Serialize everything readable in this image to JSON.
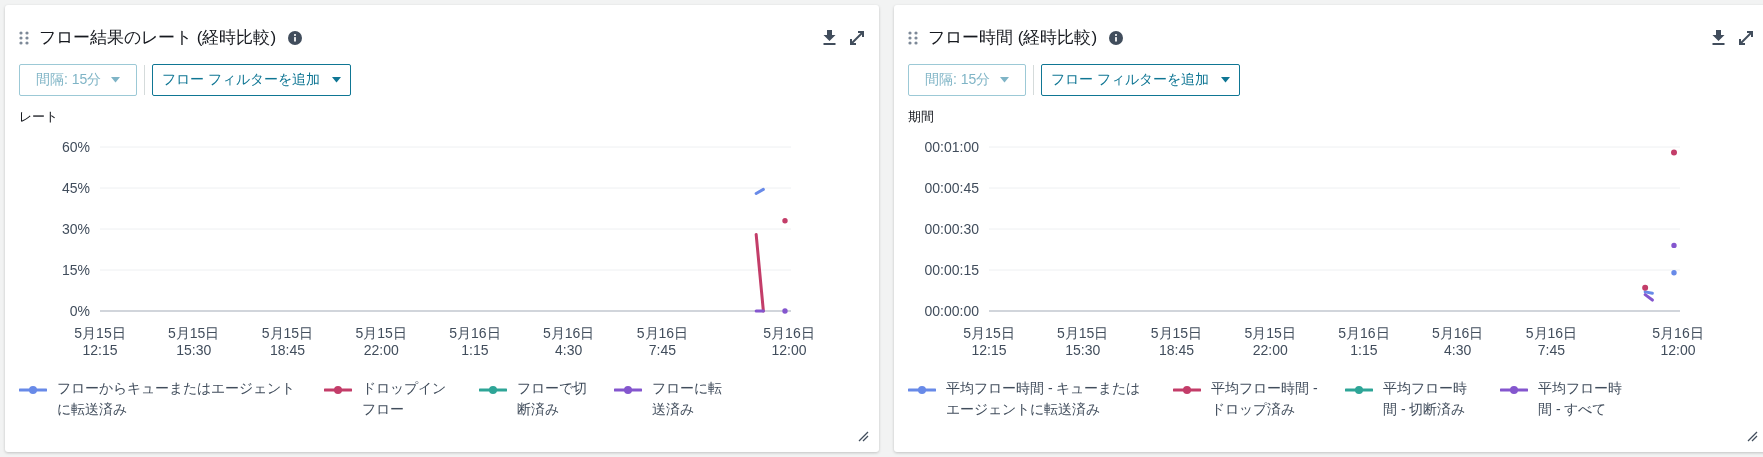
{
  "panels": [
    {
      "title": "フロー結果のレート (経時比較)",
      "interval": {
        "label": "間隔: 15分",
        "disabled": true
      },
      "filter": {
        "label": "フロー フィルターを追加"
      },
      "axis_label": "レート",
      "chart_data": {
        "type": "line",
        "grid": true,
        "legend": true,
        "categories": [
          "5月15日\n12:15",
          null,
          null,
          null,
          null,
          null,
          null,
          null,
          null,
          null,
          null,
          null,
          null,
          "5月15日\n15:30",
          null,
          null,
          null,
          null,
          null,
          null,
          null,
          null,
          null,
          null,
          null,
          null,
          "5月15日\n18:45",
          null,
          null,
          null,
          null,
          null,
          null,
          null,
          null,
          null,
          null,
          null,
          null,
          "5月15日\n22:00",
          null,
          null,
          null,
          null,
          null,
          null,
          null,
          null,
          null,
          null,
          null,
          null,
          "5月16日\n1:15",
          null,
          null,
          null,
          null,
          null,
          null,
          null,
          null,
          null,
          null,
          null,
          null,
          "5月16日\n4:30",
          null,
          null,
          null,
          null,
          null,
          null,
          null,
          null,
          null,
          null,
          null,
          null,
          "5月16日\n7:45",
          null,
          null,
          null,
          null,
          null,
          null,
          null,
          null,
          null,
          null,
          null,
          null,
          null,
          null,
          null,
          null,
          "5月16日\n12:00"
        ],
        "ylim": [
          0,
          60
        ],
        "yticks": [
          {
            "value": 0,
            "label": "0%"
          },
          {
            "value": 15,
            "label": "15%"
          },
          {
            "value": 30,
            "label": "30%"
          },
          {
            "value": 45,
            "label": "45%"
          },
          {
            "value": 60,
            "label": "60%"
          }
        ],
        "series": [
          {
            "name": "フローからキューまたはエージェントに転送済み",
            "color": "#688ae8",
            "values": [
              null,
              null,
              null,
              null,
              null,
              null,
              null,
              null,
              null,
              null,
              null,
              null,
              null,
              null,
              null,
              null,
              null,
              null,
              null,
              null,
              null,
              null,
              null,
              null,
              null,
              null,
              null,
              null,
              null,
              null,
              null,
              null,
              null,
              null,
              null,
              null,
              null,
              null,
              null,
              null,
              null,
              null,
              null,
              null,
              null,
              null,
              null,
              null,
              null,
              null,
              null,
              null,
              null,
              null,
              null,
              null,
              null,
              null,
              null,
              null,
              null,
              null,
              null,
              null,
              null,
              null,
              null,
              null,
              null,
              null,
              null,
              null,
              null,
              null,
              null,
              null,
              null,
              null,
              null,
              null,
              null,
              null,
              null,
              null,
              null,
              null,
              null,
              null,
              null,
              null,
              null,
              43,
              44.5,
              null,
              null,
              null
            ]
          },
          {
            "name": "ドロップインフロー",
            "color": "#c33d69",
            "values": [
              null,
              null,
              null,
              null,
              null,
              null,
              null,
              null,
              null,
              null,
              null,
              null,
              null,
              null,
              null,
              null,
              null,
              null,
              null,
              null,
              null,
              null,
              null,
              null,
              null,
              null,
              null,
              null,
              null,
              null,
              null,
              null,
              null,
              null,
              null,
              null,
              null,
              null,
              null,
              null,
              null,
              null,
              null,
              null,
              null,
              null,
              null,
              null,
              null,
              null,
              null,
              null,
              null,
              null,
              null,
              null,
              null,
              null,
              null,
              null,
              null,
              null,
              null,
              null,
              null,
              null,
              null,
              null,
              null,
              null,
              null,
              null,
              null,
              null,
              null,
              null,
              null,
              null,
              null,
              null,
              null,
              null,
              null,
              null,
              null,
              null,
              null,
              null,
              null,
              null,
              null,
              28,
              0,
              null,
              null,
              33
            ]
          },
          {
            "name": "フローで切断済み",
            "color": "#2ea597",
            "values": [
              null,
              null,
              null,
              null,
              null,
              null,
              null,
              null,
              null,
              null,
              null,
              null,
              null,
              null,
              null,
              null,
              null,
              null,
              null,
              null,
              null,
              null,
              null,
              null,
              null,
              null,
              null,
              null,
              null,
              null,
              null,
              null,
              null,
              null,
              null,
              null,
              null,
              null,
              null,
              null,
              null,
              null,
              null,
              null,
              null,
              null,
              null,
              null,
              null,
              null,
              null,
              null,
              null,
              null,
              null,
              null,
              null,
              null,
              null,
              null,
              null,
              null,
              null,
              null,
              null,
              null,
              null,
              null,
              null,
              null,
              null,
              null,
              null,
              null,
              null,
              null,
              null,
              null,
              null,
              null,
              null,
              null,
              null,
              null,
              null,
              null,
              null,
              null,
              null,
              null,
              null,
              null,
              null,
              null,
              null,
              null
            ]
          },
          {
            "name": "フローに転送済み",
            "color": "#8456ce",
            "values": [
              null,
              null,
              null,
              null,
              null,
              null,
              null,
              null,
              null,
              null,
              null,
              null,
              null,
              null,
              null,
              null,
              null,
              null,
              null,
              null,
              null,
              null,
              null,
              null,
              null,
              null,
              null,
              null,
              null,
              null,
              null,
              null,
              null,
              null,
              null,
              null,
              null,
              null,
              null,
              null,
              null,
              null,
              null,
              null,
              null,
              null,
              null,
              null,
              null,
              null,
              null,
              null,
              null,
              null,
              null,
              null,
              null,
              null,
              null,
              null,
              null,
              null,
              null,
              null,
              null,
              null,
              null,
              null,
              null,
              null,
              null,
              null,
              null,
              null,
              null,
              null,
              null,
              null,
              null,
              null,
              null,
              null,
              null,
              null,
              null,
              null,
              null,
              null,
              null,
              null,
              null,
              0,
              0,
              null,
              null,
              0
            ]
          }
        ]
      }
    },
    {
      "title": "フロー時間 (経時比較)",
      "interval": {
        "label": "間隔: 15分",
        "disabled": true
      },
      "filter": {
        "label": "フロー フィルターを追加"
      },
      "axis_label": "期間",
      "chart_data": {
        "type": "line",
        "grid": true,
        "legend": true,
        "categories": [
          "5月15日\n12:15",
          null,
          null,
          null,
          null,
          null,
          null,
          null,
          null,
          null,
          null,
          null,
          null,
          "5月15日\n15:30",
          null,
          null,
          null,
          null,
          null,
          null,
          null,
          null,
          null,
          null,
          null,
          null,
          "5月15日\n18:45",
          null,
          null,
          null,
          null,
          null,
          null,
          null,
          null,
          null,
          null,
          null,
          null,
          "5月15日\n22:00",
          null,
          null,
          null,
          null,
          null,
          null,
          null,
          null,
          null,
          null,
          null,
          null,
          "5月16日\n1:15",
          null,
          null,
          null,
          null,
          null,
          null,
          null,
          null,
          null,
          null,
          null,
          null,
          "5月16日\n4:30",
          null,
          null,
          null,
          null,
          null,
          null,
          null,
          null,
          null,
          null,
          null,
          null,
          "5月16日\n7:45",
          null,
          null,
          null,
          null,
          null,
          null,
          null,
          null,
          null,
          null,
          null,
          null,
          null,
          null,
          null,
          null,
          "5月16日\n12:00"
        ],
        "ylim": [
          0,
          60
        ],
        "yticks": [
          {
            "value": 0,
            "label": "00:00:00"
          },
          {
            "value": 15,
            "label": "00:00:15"
          },
          {
            "value": 30,
            "label": "00:00:30"
          },
          {
            "value": 45,
            "label": "00:00:45"
          },
          {
            "value": 60,
            "label": "00:01:00"
          }
        ],
        "series": [
          {
            "name": "平均フロー時間 - キューまたはエージェントに転送済み",
            "color": "#688ae8",
            "values": [
              null,
              null,
              null,
              null,
              null,
              null,
              null,
              null,
              null,
              null,
              null,
              null,
              null,
              null,
              null,
              null,
              null,
              null,
              null,
              null,
              null,
              null,
              null,
              null,
              null,
              null,
              null,
              null,
              null,
              null,
              null,
              null,
              null,
              null,
              null,
              null,
              null,
              null,
              null,
              null,
              null,
              null,
              null,
              null,
              null,
              null,
              null,
              null,
              null,
              null,
              null,
              null,
              null,
              null,
              null,
              null,
              null,
              null,
              null,
              null,
              null,
              null,
              null,
              null,
              null,
              null,
              null,
              null,
              null,
              null,
              null,
              null,
              null,
              null,
              null,
              null,
              null,
              null,
              null,
              null,
              null,
              null,
              null,
              null,
              null,
              null,
              null,
              null,
              null,
              null,
              null,
              7,
              6.5,
              null,
              null,
              14
            ]
          },
          {
            "name": "平均フロー時間 - ドロップ済み",
            "type": "scatter",
            "color": "#c33d69",
            "values": [
              null,
              null,
              null,
              null,
              null,
              null,
              null,
              null,
              null,
              null,
              null,
              null,
              null,
              null,
              null,
              null,
              null,
              null,
              null,
              null,
              null,
              null,
              null,
              null,
              null,
              null,
              null,
              null,
              null,
              null,
              null,
              null,
              null,
              null,
              null,
              null,
              null,
              null,
              null,
              null,
              null,
              null,
              null,
              null,
              null,
              null,
              null,
              null,
              null,
              null,
              null,
              null,
              null,
              null,
              null,
              null,
              null,
              null,
              null,
              null,
              null,
              null,
              null,
              null,
              null,
              null,
              null,
              null,
              null,
              null,
              null,
              null,
              null,
              null,
              null,
              null,
              null,
              null,
              null,
              null,
              null,
              null,
              null,
              null,
              null,
              null,
              null,
              null,
              null,
              null,
              null,
              8.5,
              null,
              null,
              null,
              58
            ]
          },
          {
            "name": "平均フロー時間 - 切断済み",
            "color": "#2ea597",
            "values": [
              null,
              null,
              null,
              null,
              null,
              null,
              null,
              null,
              null,
              null,
              null,
              null,
              null,
              null,
              null,
              null,
              null,
              null,
              null,
              null,
              null,
              null,
              null,
              null,
              null,
              null,
              null,
              null,
              null,
              null,
              null,
              null,
              null,
              null,
              null,
              null,
              null,
              null,
              null,
              null,
              null,
              null,
              null,
              null,
              null,
              null,
              null,
              null,
              null,
              null,
              null,
              null,
              null,
              null,
              null,
              null,
              null,
              null,
              null,
              null,
              null,
              null,
              null,
              null,
              null,
              null,
              null,
              null,
              null,
              null,
              null,
              null,
              null,
              null,
              null,
              null,
              null,
              null,
              null,
              null,
              null,
              null,
              null,
              null,
              null,
              null,
              null,
              null,
              null,
              null,
              null,
              null,
              null,
              null,
              null,
              null
            ]
          },
          {
            "name": "平均フロー時間 - すべて",
            "color": "#8456ce",
            "values": [
              null,
              null,
              null,
              null,
              null,
              null,
              null,
              null,
              null,
              null,
              null,
              null,
              null,
              null,
              null,
              null,
              null,
              null,
              null,
              null,
              null,
              null,
              null,
              null,
              null,
              null,
              null,
              null,
              null,
              null,
              null,
              null,
              null,
              null,
              null,
              null,
              null,
              null,
              null,
              null,
              null,
              null,
              null,
              null,
              null,
              null,
              null,
              null,
              null,
              null,
              null,
              null,
              null,
              null,
              null,
              null,
              null,
              null,
              null,
              null,
              null,
              null,
              null,
              null,
              null,
              null,
              null,
              null,
              null,
              null,
              null,
              null,
              null,
              null,
              null,
              null,
              null,
              null,
              null,
              null,
              null,
              null,
              null,
              null,
              null,
              null,
              null,
              null,
              null,
              null,
              null,
              6,
              4,
              null,
              null,
              24
            ]
          }
        ]
      }
    }
  ]
}
